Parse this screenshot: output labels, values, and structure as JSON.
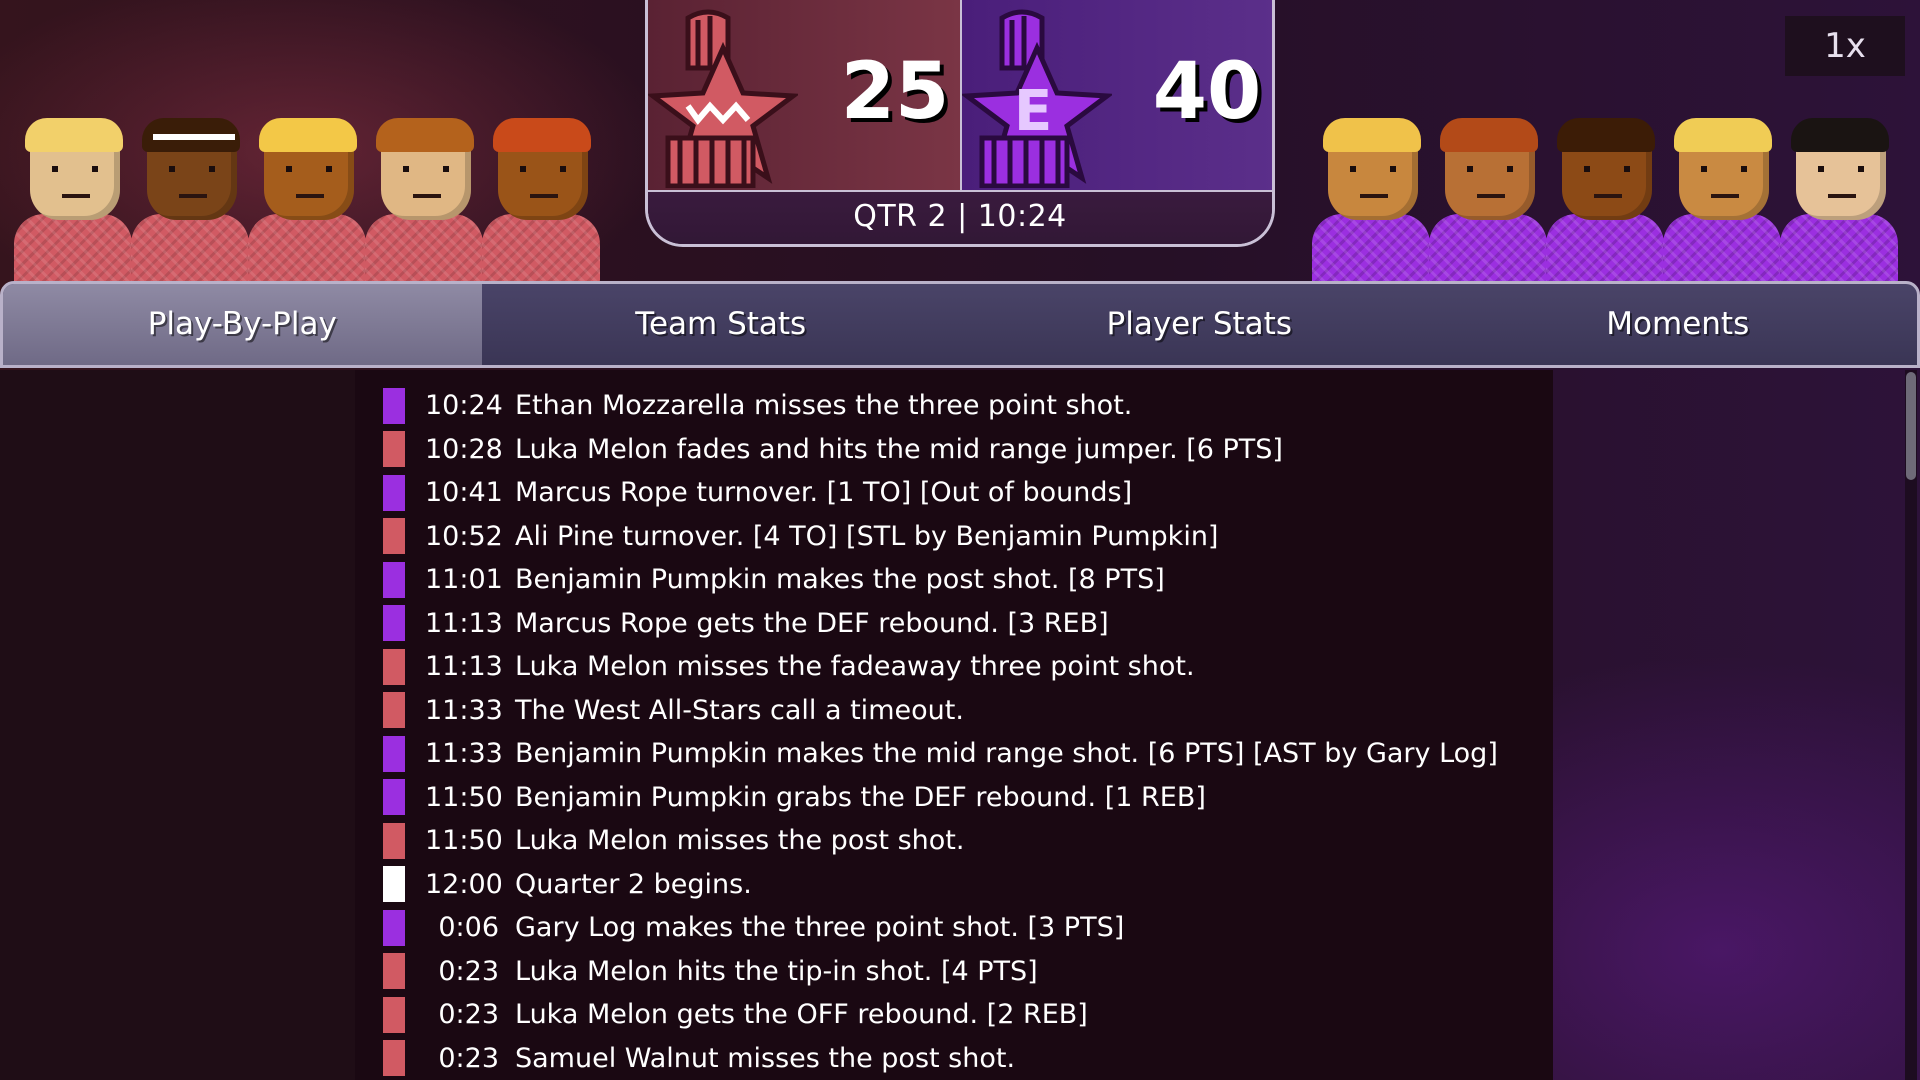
{
  "colors": {
    "west": "#d15a63",
    "east": "#9b2fe0",
    "neutral": "#ffffff"
  },
  "scoreboard": {
    "west": {
      "score": "25",
      "logo": "star-logo-west"
    },
    "east": {
      "score": "40",
      "logo": "star-logo-east",
      "logo_letter": "E"
    },
    "clock": "QTR 2  |  10:24"
  },
  "speed_label": "1x",
  "tabs": [
    {
      "label": "Play-By-Play",
      "active": true
    },
    {
      "label": "Team Stats",
      "active": false
    },
    {
      "label": "Player Stats",
      "active": false
    },
    {
      "label": "Moments",
      "active": false
    }
  ],
  "plays": [
    {
      "team": "east",
      "time": "10:24",
      "text": "Ethan Mozzarella misses the three point shot."
    },
    {
      "team": "west",
      "time": "10:28",
      "text": "Luka Melon fades and hits the mid range jumper. [6 PTS]"
    },
    {
      "team": "east",
      "time": "10:41",
      "text": "Marcus Rope turnover. [1 TO] [Out of bounds]"
    },
    {
      "team": "west",
      "time": "10:52",
      "text": "Ali Pine turnover. [4 TO] [STL by Benjamin Pumpkin]"
    },
    {
      "team": "east",
      "time": "11:01",
      "text": "Benjamin Pumpkin makes the post shot. [8 PTS]"
    },
    {
      "team": "east",
      "time": "11:13",
      "text": "Marcus Rope gets the DEF rebound. [3 REB]"
    },
    {
      "team": "west",
      "time": "11:13",
      "text": "Luka Melon misses the fadeaway three point shot."
    },
    {
      "team": "west",
      "time": "11:33",
      "text": "The West All-Stars call a timeout."
    },
    {
      "team": "east",
      "time": "11:33",
      "text": "Benjamin Pumpkin makes the mid range shot. [6 PTS] [AST by Gary Log]"
    },
    {
      "team": "east",
      "time": "11:50",
      "text": "Benjamin Pumpkin grabs the DEF rebound. [1 REB]"
    },
    {
      "team": "west",
      "time": "11:50",
      "text": "Luka Melon misses the post shot."
    },
    {
      "team": "neutral",
      "time": "12:00",
      "text": "Quarter 2 begins."
    },
    {
      "team": "east",
      "time": "0:06",
      "text": "Gary Log makes the three point shot. [3 PTS]"
    },
    {
      "team": "west",
      "time": "0:23",
      "text": "Luka Melon hits the tip-in shot. [4 PTS]"
    },
    {
      "team": "west",
      "time": "0:23",
      "text": "Luka Melon gets the OFF rebound. [2 REB]"
    },
    {
      "team": "west",
      "time": "0:23",
      "text": "Samuel Walnut misses the post shot."
    }
  ],
  "west_players": [
    {
      "skin": "#e2c08e",
      "hair": "#f2d06a"
    },
    {
      "skin": "#7a4418",
      "hair": "#3a1d08",
      "headband": true
    },
    {
      "skin": "#a55d1c",
      "hair": "#f3c847"
    },
    {
      "skin": "#e0b784",
      "hair": "#b4621c"
    },
    {
      "skin": "#9a5418",
      "hair": "#c94a1a"
    }
  ],
  "east_players": [
    {
      "skin": "#c8873e",
      "hair": "#f0c24a"
    },
    {
      "skin": "#b87035",
      "hair": "#b34a18"
    },
    {
      "skin": "#8c4a16",
      "hair": "#3c1c06"
    },
    {
      "skin": "#c98a42",
      "hair": "#f0cc55"
    },
    {
      "skin": "#e6c298",
      "hair": "#1a1412"
    }
  ]
}
